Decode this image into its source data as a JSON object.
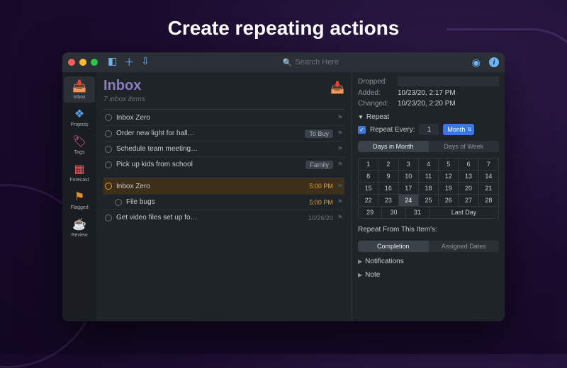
{
  "headline": "Create repeating actions",
  "toolbar": {
    "search_placeholder": "Search Here"
  },
  "sidebar": {
    "items": [
      {
        "icon": "📥",
        "label": "Inbox",
        "selected": true
      },
      {
        "icon": "❖",
        "label": "Projects",
        "color": "#5aa0e8"
      },
      {
        "icon": "🏷",
        "label": "Tags",
        "color": "#e85aa0"
      },
      {
        "icon": "▦",
        "label": "Forecast",
        "color": "#e85a5a"
      },
      {
        "icon": "⚑",
        "label": "Flagged",
        "color": "#e09030"
      },
      {
        "icon": "☕",
        "label": "Review",
        "color": "#8a7bbf"
      }
    ]
  },
  "main": {
    "title": "Inbox",
    "subtitle": "7 inbox items",
    "groups": [
      {
        "items": [
          {
            "title": "Inbox Zero"
          },
          {
            "title": "Order new light for hall…",
            "tag": "To Buy"
          },
          {
            "title": "Schedule team meeting…"
          },
          {
            "title": "Pick up kids from school",
            "tag": "Family"
          }
        ]
      },
      {
        "items": [
          {
            "title": "Inbox Zero",
            "time": "5:00 PM",
            "selected": true
          },
          {
            "title": "File bugs",
            "time": "5:00 PM",
            "child": true
          },
          {
            "title": "Get video files set up fo…",
            "date": "10/26/20"
          }
        ]
      }
    ]
  },
  "inspector": {
    "dropped_label": "Dropped:",
    "added_label": "Added:",
    "added_value": "10/23/20, 2:17 PM",
    "changed_label": "Changed:",
    "changed_value": "10/23/20, 2:20 PM",
    "repeat": {
      "section_label": "Repeat",
      "every_label": "Repeat Every:",
      "every_value": "1",
      "every_unit": "Month",
      "segments": [
        "Days in Month",
        "Days of Week"
      ],
      "selected_segment": 0,
      "selected_day": 24,
      "last_day_label": "Last Day",
      "from_label": "Repeat From This Item's:",
      "from_options": [
        "Completion",
        "Assigned Dates"
      ],
      "from_selected": 0
    },
    "notifications_label": "Notifications",
    "note_label": "Note"
  }
}
